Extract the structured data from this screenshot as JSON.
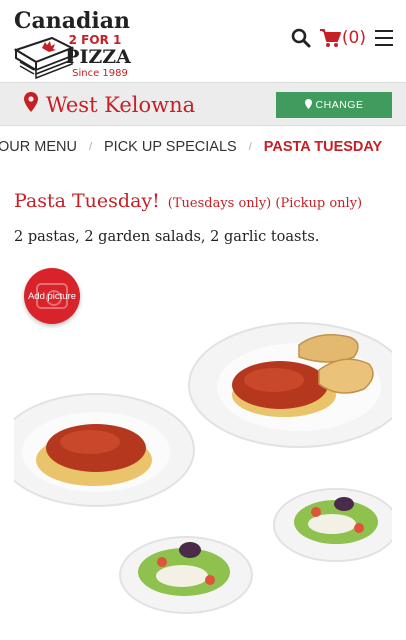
{
  "header": {
    "logo": {
      "line1": "Canadian",
      "line2": "2 FOR 1",
      "line3": "PIZZA",
      "line4": "Since 1989"
    },
    "cart_count": "(0)"
  },
  "location_bar": {
    "city": "West Kelowna",
    "change_label": "CHANGE"
  },
  "breadcrumbs": {
    "items": [
      "OUR MENU",
      "PICK UP SPECIALS",
      "PASTA TUESDAY"
    ],
    "separator": "/"
  },
  "content": {
    "title": "Pasta Tuesday!",
    "note": "(Tuesdays only) (Pickup only)",
    "description": "2 pastas, 2 garden salads, 2 garlic toasts.",
    "add_picture_label": "Add picture"
  },
  "colors": {
    "brand_red": "#c62026",
    "change_green": "#3f9c5e",
    "location_bar_bg": "#ececec"
  }
}
